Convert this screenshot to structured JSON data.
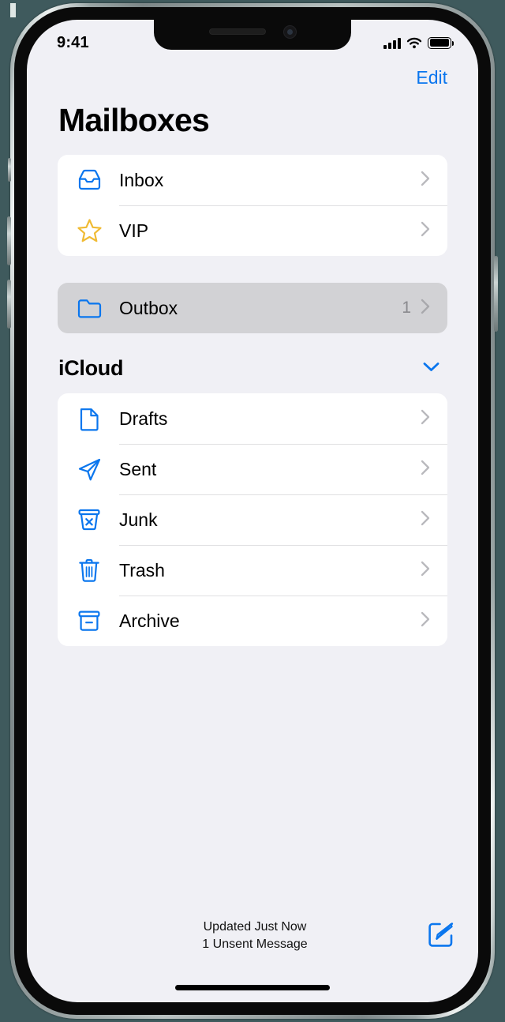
{
  "status_bar": {
    "time": "9:41",
    "signal_icon": "cellular-signal-icon",
    "wifi_icon": "wifi-icon",
    "battery_icon": "battery-full-icon"
  },
  "nav": {
    "edit_label": "Edit"
  },
  "page": {
    "title": "Mailboxes"
  },
  "colors": {
    "accent_blue": "#0a76ee",
    "vip_yellow": "#f0bb34",
    "screen_background": "#f0f0f5",
    "card_background": "#ffffff",
    "pressed_row_background": "#d2d2d5",
    "separator": "#e0e0e2",
    "secondary_text": "#8a8a8e"
  },
  "mailboxes_group": {
    "items": [
      {
        "label": "Inbox",
        "icon": "inbox-tray-icon",
        "count": "",
        "accessory": "chevron-right-icon"
      },
      {
        "label": "VIP",
        "icon": "star-icon",
        "count": "",
        "accessory": "chevron-right-icon"
      }
    ]
  },
  "outbox_group": {
    "items": [
      {
        "label": "Outbox",
        "icon": "folder-icon",
        "count": "1",
        "accessory": "chevron-right-icon",
        "state": "pressed"
      }
    ]
  },
  "icloud_section": {
    "title": "iCloud",
    "collapse_icon": "chevron-down-icon",
    "items": [
      {
        "label": "Drafts",
        "icon": "document-icon",
        "count": "",
        "accessory": "chevron-right-icon"
      },
      {
        "label": "Sent",
        "icon": "paper-plane-icon",
        "count": "",
        "accessory": "chevron-right-icon"
      },
      {
        "label": "Junk",
        "icon": "junk-bin-icon",
        "count": "",
        "accessory": "chevron-right-icon"
      },
      {
        "label": "Trash",
        "icon": "trash-can-icon",
        "count": "",
        "accessory": "chevron-right-icon"
      },
      {
        "label": "Archive",
        "icon": "archive-box-icon",
        "count": "",
        "accessory": "chevron-right-icon"
      }
    ]
  },
  "toolbar": {
    "status_line_1": "Updated Just Now",
    "status_line_2": "1 Unsent Message",
    "compose_icon": "compose-icon"
  }
}
